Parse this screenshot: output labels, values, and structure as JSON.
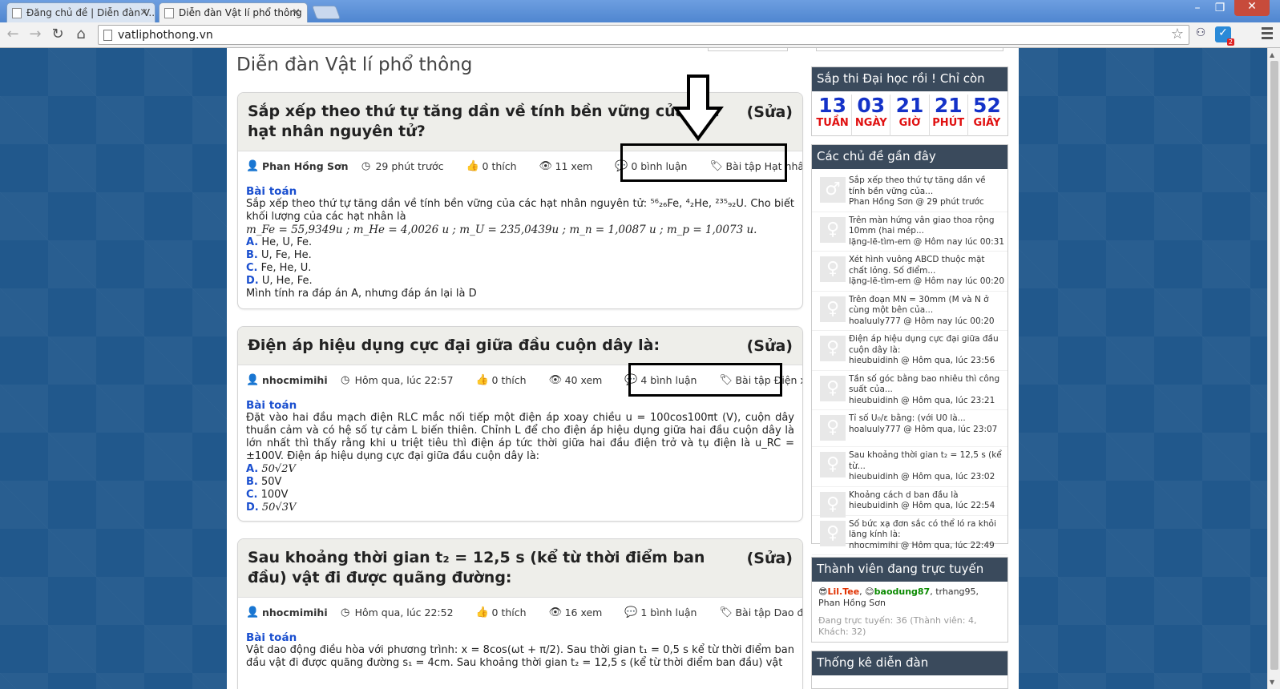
{
  "browser": {
    "tabs": [
      {
        "label": "Đăng chủ đề | Diễn đàn V..."
      },
      {
        "label": "Diễn đàn Vật lí phổ thông"
      }
    ],
    "url": "vatliphothong.vn",
    "ext_badge": "2"
  },
  "page": {
    "title": "Diễn đàn Vật lí phổ thông"
  },
  "posts": [
    {
      "title": "Sắp xếp theo thứ tự tăng dần về tính bền vững của các hạt nhân nguyên tử?",
      "edit": "(Sửa)",
      "author": "Phan Hồng Sơn",
      "time": "29 phút trước",
      "likes": "0 thích",
      "views": "11 xem",
      "comments": "0 bình luận",
      "tag": "Bài tập Hạt nhân nguyên tử",
      "label": "Bài toán",
      "text": "Sắp xếp theo thứ tự tăng dần về tính bền vững của các hạt nhân nguyên tử: ⁵⁶₂₆Fe, ⁴₂He, ²³⁵₉₂U. Cho biết khối lượng của các hạt nhân là",
      "formula": "m_Fe = 55,9349u ; m_He = 4,0026 u ; m_U = 235,0439u ; m_n = 1,0087 u ; m_p = 1,0073 u.",
      "options": [
        {
          "key": "A.",
          "val": "He, U, Fe."
        },
        {
          "key": "B.",
          "val": "U, Fe, He."
        },
        {
          "key": "C.",
          "val": "Fe, He, U."
        },
        {
          "key": "D.",
          "val": "U, He, Fe."
        }
      ],
      "note": "Mình tính ra đáp án A, nhưng đáp án lại là D"
    },
    {
      "title": "Điện áp hiệu dụng cực đại giữa đầu cuộn dây là:",
      "edit": "(Sửa)",
      "author": "nhocmimihi",
      "time": "Hôm qua, lúc 22:57",
      "likes": "0 thích",
      "views": "40 xem",
      "comments": "4 bình luận",
      "tag": "Bài tập Điện xoay chiều",
      "label": "Bài toán",
      "text": "Đặt vào hai đầu mạch điện RLC mắc nối tiếp một điện áp xoay chiều u = 100cos100πt (V), cuộn dây thuần cảm và có hệ số tự cảm L biến thiên. Chỉnh L để cho điện áp hiệu dụng giữa hai đầu cuộn dây là lớn nhất thì thấy rằng khi u triệt tiêu thì điện áp tức thời giữa hai đầu điện trở và tụ điện là u_RC = ±100V. Điện áp hiệu dụng cực đại giữa đầu cuộn dây là:",
      "options": [
        {
          "key": "A.",
          "val": "50√2V"
        },
        {
          "key": "B.",
          "val": "50V"
        },
        {
          "key": "C.",
          "val": "100V"
        },
        {
          "key": "D.",
          "val": "50√3V"
        }
      ]
    },
    {
      "title": "Sau khoảng thời gian t₂ = 12,5 s (kể từ thời điểm ban đầu) vật đi được quãng đường:",
      "edit": "(Sửa)",
      "author": "nhocmimihi",
      "time": "Hôm qua, lúc 22:52",
      "likes": "0 thích",
      "views": "16 xem",
      "comments": "1 bình luận",
      "tag": "Bài tập Dao động cơ",
      "label": "Bài toán",
      "text": "Vật dao động điều hòa với phương trình: x = 8cos(ωt + π/2). Sau thời gian t₁ = 0,5 s kể từ thời điểm ban đầu vật đi được quãng đường s₁ = 4cm. Sau khoảng thời gian t₂ = 12,5 s (kể từ thời điểm ban đầu) vật"
    }
  ],
  "sidebar": {
    "countdown": {
      "title": "Sắp thi Đại học rồi ! Chỉ còn",
      "cells": [
        {
          "num": "13",
          "unit": "TUẦN"
        },
        {
          "num": "03",
          "unit": "NGÀY"
        },
        {
          "num": "21",
          "unit": "GIỜ"
        },
        {
          "num": "21",
          "unit": "PHÚT"
        },
        {
          "num": "52",
          "unit": "GIÂY"
        }
      ]
    },
    "recent": {
      "title": "Các chủ đề gần đây",
      "items": [
        {
          "text": "Sắp xếp theo thứ tự tăng dần về tính bền vững của...",
          "by": "Phan Hồng Sơn @ 29 phút trước",
          "icon": "male"
        },
        {
          "text": "Trên màn hứng vân giao thoa rộng 10mm (hai mép...",
          "by": "lặng-lẽ-tìm-em @ Hôm nay lúc 00:31",
          "icon": "female"
        },
        {
          "text": "Xét hình vuông ABCD thuộc mặt chất lỏng. Số điểm...",
          "by": "lặng-lẽ-tìm-em @ Hôm nay lúc 00:20",
          "icon": "female"
        },
        {
          "text": "Trên đoạn MN = 30mm (M và N ở cùng một bên của...",
          "by": "hoaluuly777 @ Hôm nay lúc 00:20",
          "icon": "female"
        },
        {
          "text": "Điện áp hiệu dụng cực đại giữa đầu cuộn dây là:",
          "by": "hieubuidinh @ Hôm qua, lúc 23:56",
          "icon": "female"
        },
        {
          "text": "Tần số góc bằng bao nhiêu thì công suất của...",
          "by": "hieubuidinh @ Hôm qua, lúc 23:21",
          "icon": "female"
        },
        {
          "text": "Tỉ số U₀/ε bằng: (với U0 là...",
          "by": "hoaluuly777 @ Hôm qua, lúc 23:07",
          "icon": "female"
        },
        {
          "text": "Sau khoảng thời gian t₂ = 12,5 s (kể từ...",
          "by": "hieubuidinh @ Hôm qua, lúc 23:02",
          "icon": "female"
        },
        {
          "text": "Khoảng cách d ban đầu là",
          "by": "hieubuidinh @ Hôm qua, lúc 22:54",
          "icon": "female"
        },
        {
          "text": "Số bức xạ đơn sắc có thể ló ra khỏi lăng kính là:",
          "by": "nhocmimihi @ Hôm qua, lúc 22:49",
          "icon": "female"
        }
      ]
    },
    "online": {
      "title": "Thành viên đang trực tuyến",
      "user1": "Lil.Tee",
      "user2": "baodung87",
      "rest": ", trhang95,",
      "user4": "Phan Hồng Sơn",
      "stats": "Đang trực tuyến: 36 (Thành viên: 4, Khách: 32)"
    },
    "stats_title": "Thống kê diễn đàn"
  },
  "colors": {
    "accent": "#1a4fcf",
    "countdown_num": "#1432c8",
    "countdown_unit": "#e01010",
    "sidebar_header": "#3a4a5c"
  }
}
